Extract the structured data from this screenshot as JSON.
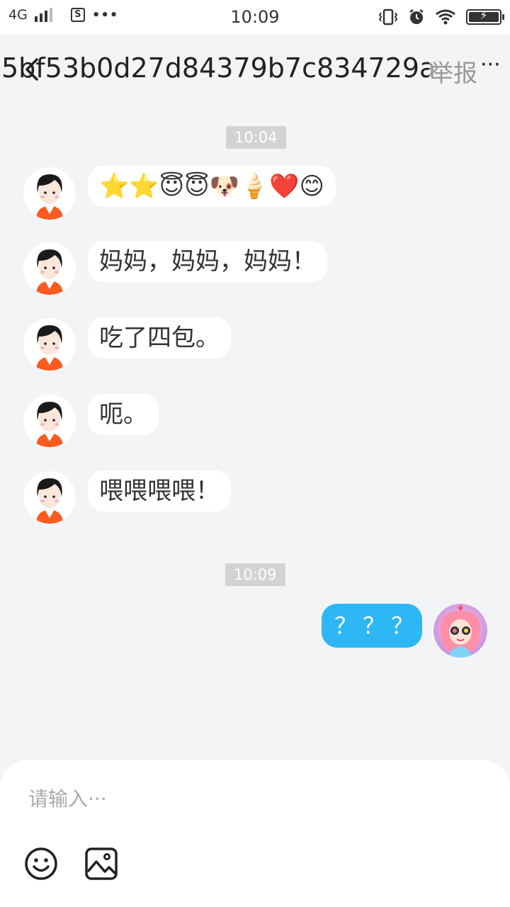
{
  "status_bar": {
    "network": "4G",
    "time": "10:09",
    "more": "•••"
  },
  "header": {
    "title": "5bf53b0d27d84379b7c834729a",
    "report": "举报",
    "more": "···"
  },
  "messages": [
    {
      "type": "time",
      "text": "10:04"
    },
    {
      "type": "incoming",
      "text": "⭐⭐😇😇🐶🍦❤️😊"
    },
    {
      "type": "incoming",
      "text": "妈妈，妈妈，妈妈！"
    },
    {
      "type": "incoming",
      "text": "吃了四包。"
    },
    {
      "type": "incoming",
      "text": "呃。"
    },
    {
      "type": "incoming",
      "text": "喂喂喂喂！"
    },
    {
      "type": "time",
      "text": "10:09"
    },
    {
      "type": "outgoing",
      "text": "？？？"
    }
  ],
  "input": {
    "placeholder": "请输入···"
  },
  "icons": {
    "back": "chevron-left-icon",
    "emoji": "emoji-icon",
    "image": "image-icon",
    "vibrate": "vibrate-icon",
    "alarm": "alarm-icon",
    "wifi": "wifi-icon",
    "battery": "battery-charging-icon"
  },
  "colors": {
    "outgoing_bubble": "#2db7f5",
    "background": "#f3f4f6",
    "avatar_shirt": "#ff5a1f"
  }
}
